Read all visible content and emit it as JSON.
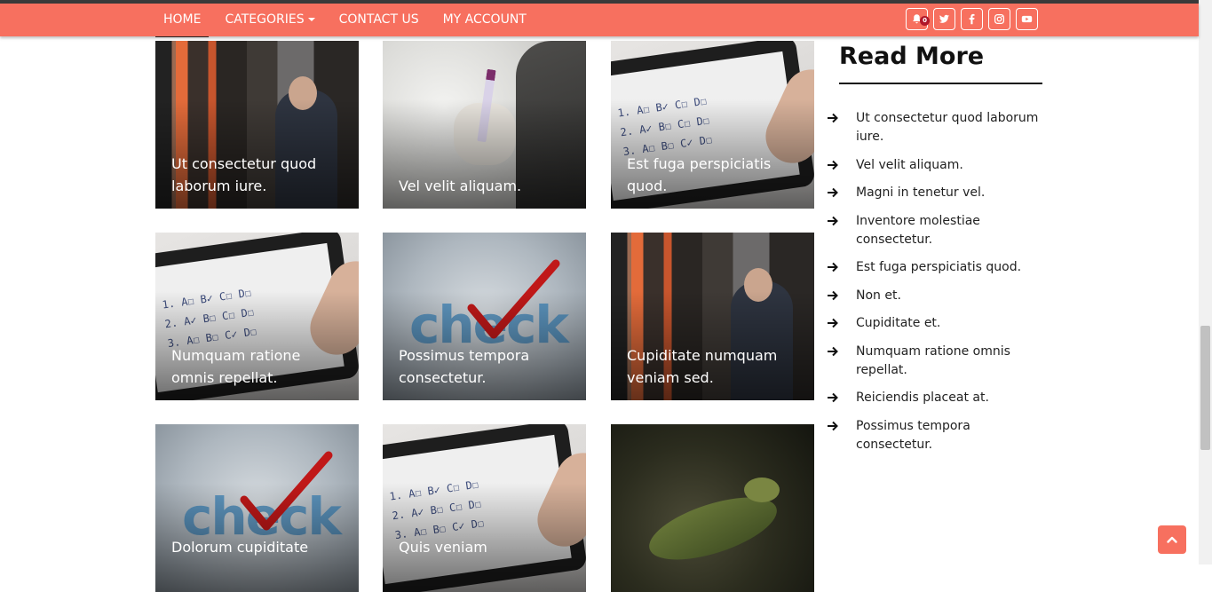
{
  "nav": {
    "items": [
      {
        "label": "HOME",
        "active": true
      },
      {
        "label": "CATEGORIES",
        "dropdown": true
      },
      {
        "label": "CONTACT US"
      },
      {
        "label": "MY ACCOUNT"
      }
    ],
    "notification_count": "0",
    "social_icons": [
      "bell-icon",
      "twitter-icon",
      "facebook-icon",
      "instagram-icon",
      "youtube-icon"
    ]
  },
  "posts": [
    {
      "title": "Ut consectetur quod laborum iure.",
      "image": "booth"
    },
    {
      "title": "Vel velit aliquam.",
      "image": "tube"
    },
    {
      "title": "Est fuga perspiciatis quod.",
      "image": "tablet"
    },
    {
      "title": "Numquam ratione omnis repellat.",
      "image": "tablet"
    },
    {
      "title": "Possimus tempora consectetur.",
      "image": "check"
    },
    {
      "title": "Cupiditate numquam veniam sed.",
      "image": "booth"
    },
    {
      "title": "Dolorum cupiditate",
      "image": "check"
    },
    {
      "title": "Quis veniam",
      "image": "tablet"
    },
    {
      "title": "",
      "image": "lizard"
    }
  ],
  "sidebar": {
    "title": "Read More",
    "links": [
      "Ut consectetur quod laborum iure.",
      "Vel velit aliquam.",
      "Magni in tenetur vel.",
      "Inventore molestiae consectetur.",
      "Est fuga perspiciatis quod.",
      "Non et.",
      "Cupiditate et.",
      "Numquam ratione omnis repellat.",
      "Reiciendis placeat at.",
      "Possimus tempora consectetur."
    ]
  },
  "colors": {
    "accent": "#f7705f",
    "badge": "#b0172a"
  }
}
